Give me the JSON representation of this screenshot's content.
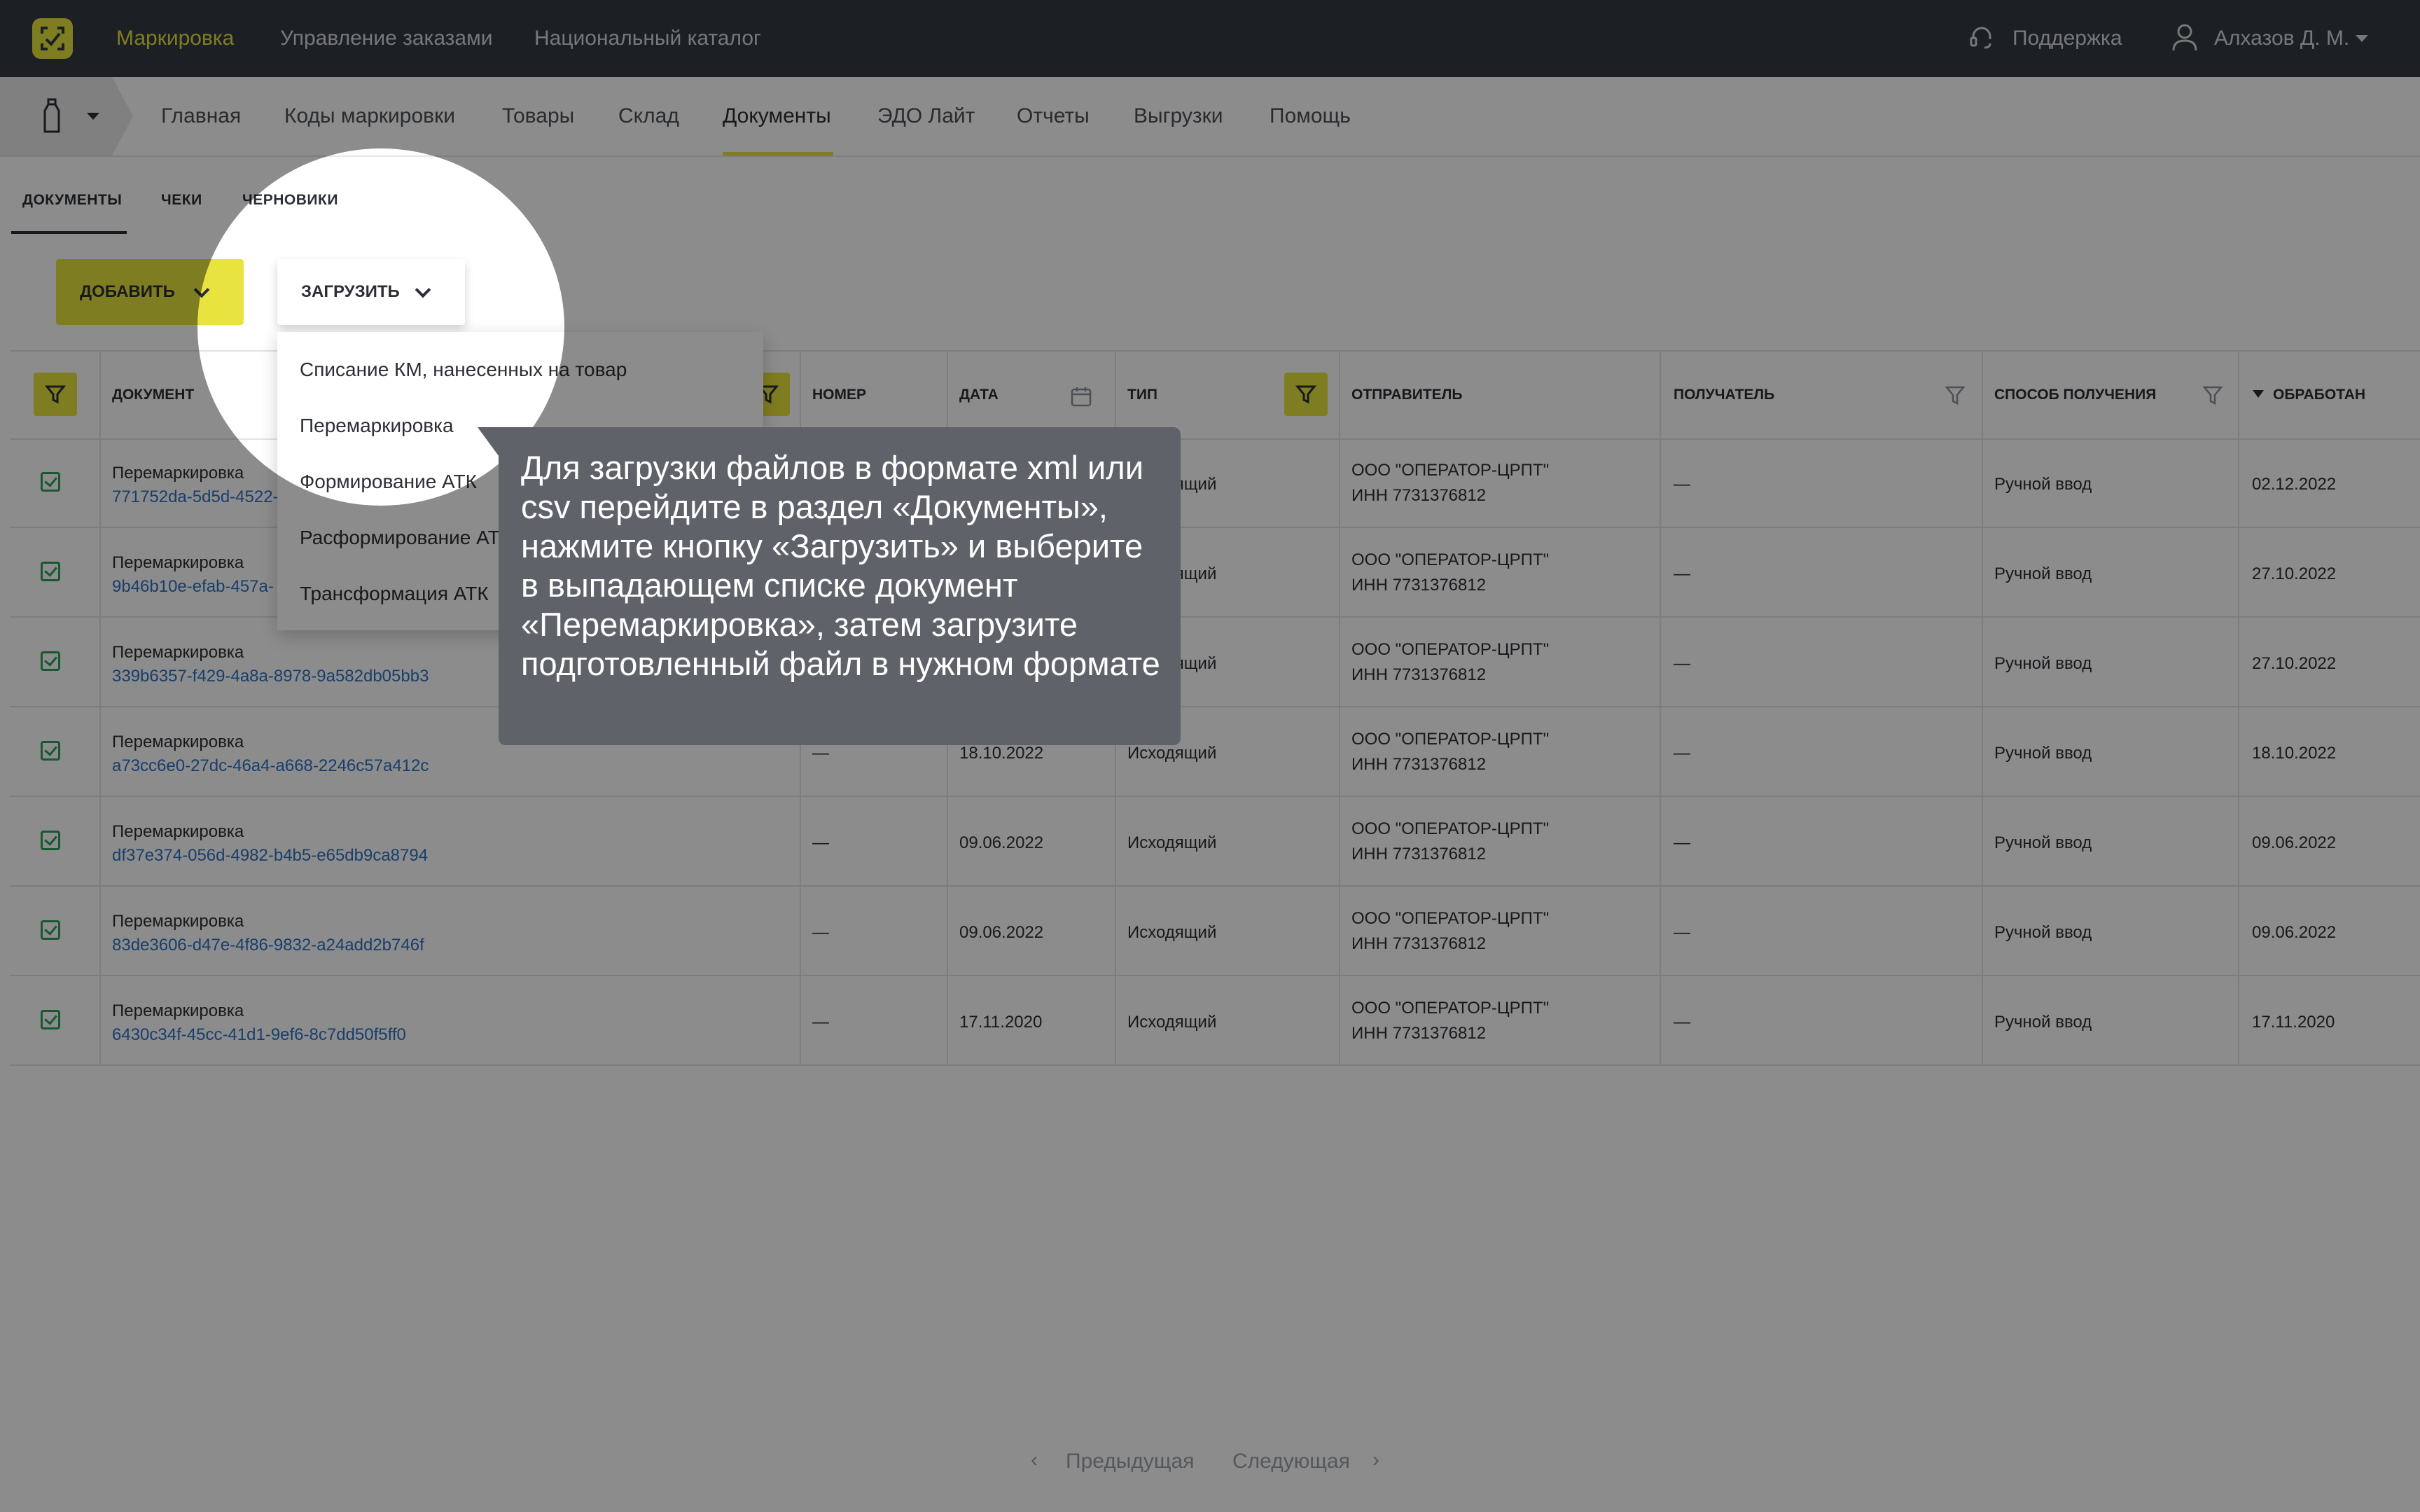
{
  "topbar": {
    "nav": [
      "Маркировка",
      "Управление заказами",
      "Национальный каталог"
    ],
    "support": "Поддержка",
    "user": "Алхазов Д. М."
  },
  "subnav": {
    "items": [
      "Главная",
      "Коды маркировки",
      "Товары",
      "Склад",
      "Документы",
      "ЭДО Лайт",
      "Отчеты",
      "Выгрузки",
      "Помощь"
    ],
    "active": "Документы"
  },
  "tabs": [
    "ДОКУМЕНТЫ",
    "ЧЕКИ",
    "ЧЕРНОВИКИ"
  ],
  "toolbar": {
    "add_label": "ДОБАВИТЬ",
    "upload_label": "ЗАГРУЗИТЬ"
  },
  "upload_menu": [
    "Списание КМ, нанесенных на товар",
    "Перемаркировка",
    "Формирование АТК",
    "Расформирование АТК",
    "Трансформация АТК"
  ],
  "table": {
    "headers": {
      "document": "ДОКУМЕНТ",
      "number": "НОМЕР",
      "date": "ДАТА",
      "type": "ТИП",
      "sender": "ОТПРАВИТЕЛЬ",
      "receiver": "ПОЛУЧАТЕЛЬ",
      "method": "СПОСОБ ПОЛУЧЕНИЯ",
      "processed": "ОБРАБОТАН"
    },
    "rows": [
      {
        "doc_type": "Перемаркировка",
        "doc_id": "771752da-5d5d-4522-",
        "number": "—",
        "date": "",
        "type": "Исходящий",
        "sender_name": "ООО \"ОПЕРАТОР-ЦРПТ\"",
        "sender_inn": "ИНН 7731376812",
        "receiver": "—",
        "method": "Ручной ввод",
        "processed": "02.12.2022"
      },
      {
        "doc_type": "Перемаркировка",
        "doc_id": "9b46b10e-efab-457a-",
        "number": "—",
        "date": "",
        "type": "Исходящий",
        "sender_name": "ООО \"ОПЕРАТОР-ЦРПТ\"",
        "sender_inn": "ИНН 7731376812",
        "receiver": "—",
        "method": "Ручной ввод",
        "processed": "27.10.2022"
      },
      {
        "doc_type": "Перемаркировка",
        "doc_id": "339b6357-f429-4a8a-8978-9a582db05bb3",
        "number": "—",
        "date": "",
        "type": "Исходящий",
        "sender_name": "ООО \"ОПЕРАТОР-ЦРПТ\"",
        "sender_inn": "ИНН 7731376812",
        "receiver": "—",
        "method": "Ручной ввод",
        "processed": "27.10.2022"
      },
      {
        "doc_type": "Перемаркировка",
        "doc_id": "a73cc6e0-27dc-46a4-a668-2246c57a412c",
        "number": "—",
        "date": "18.10.2022",
        "type": "Исходящий",
        "sender_name": "ООО \"ОПЕРАТОР-ЦРПТ\"",
        "sender_inn": "ИНН 7731376812",
        "receiver": "—",
        "method": "Ручной ввод",
        "processed": "18.10.2022"
      },
      {
        "doc_type": "Перемаркировка",
        "doc_id": "df37e374-056d-4982-b4b5-e65db9ca8794",
        "number": "—",
        "date": "09.06.2022",
        "type": "Исходящий",
        "sender_name": "ООО \"ОПЕРАТОР-ЦРПТ\"",
        "sender_inn": "ИНН 7731376812",
        "receiver": "—",
        "method": "Ручной ввод",
        "processed": "09.06.2022"
      },
      {
        "doc_type": "Перемаркировка",
        "doc_id": "83de3606-d47e-4f86-9832-a24add2b746f",
        "number": "—",
        "date": "09.06.2022",
        "type": "Исходящий",
        "sender_name": "ООО \"ОПЕРАТОР-ЦРПТ\"",
        "sender_inn": "ИНН 7731376812",
        "receiver": "—",
        "method": "Ручной ввод",
        "processed": "09.06.2022"
      },
      {
        "doc_type": "Перемаркировка",
        "doc_id": "6430c34f-45cc-41d1-9ef6-8c7dd50f5ff0",
        "number": "—",
        "date": "17.11.2020",
        "type": "Исходящий",
        "sender_name": "ООО \"ОПЕРАТОР-ЦРПТ\"",
        "sender_inn": "ИНН 7731376812",
        "receiver": "—",
        "method": "Ручной ввод",
        "processed": "17.11.2020"
      }
    ]
  },
  "pagination": {
    "prev": "Предыдущая",
    "next": "Следующая"
  },
  "tooltip": {
    "text": "Для загрузки файлов в формате xml или csv перейдите в раздел «Документы», нажмите кнопку «Загрузить» и выберите в выпадающем списке документ «Перемаркировка», затем загрузите подготовленный файл в нужном формате"
  },
  "colors": {
    "accent": "#e8e33e",
    "topbar": "#343a40",
    "link": "#2f72c4",
    "check": "#2aa056",
    "tooltip": "#5f6369"
  }
}
